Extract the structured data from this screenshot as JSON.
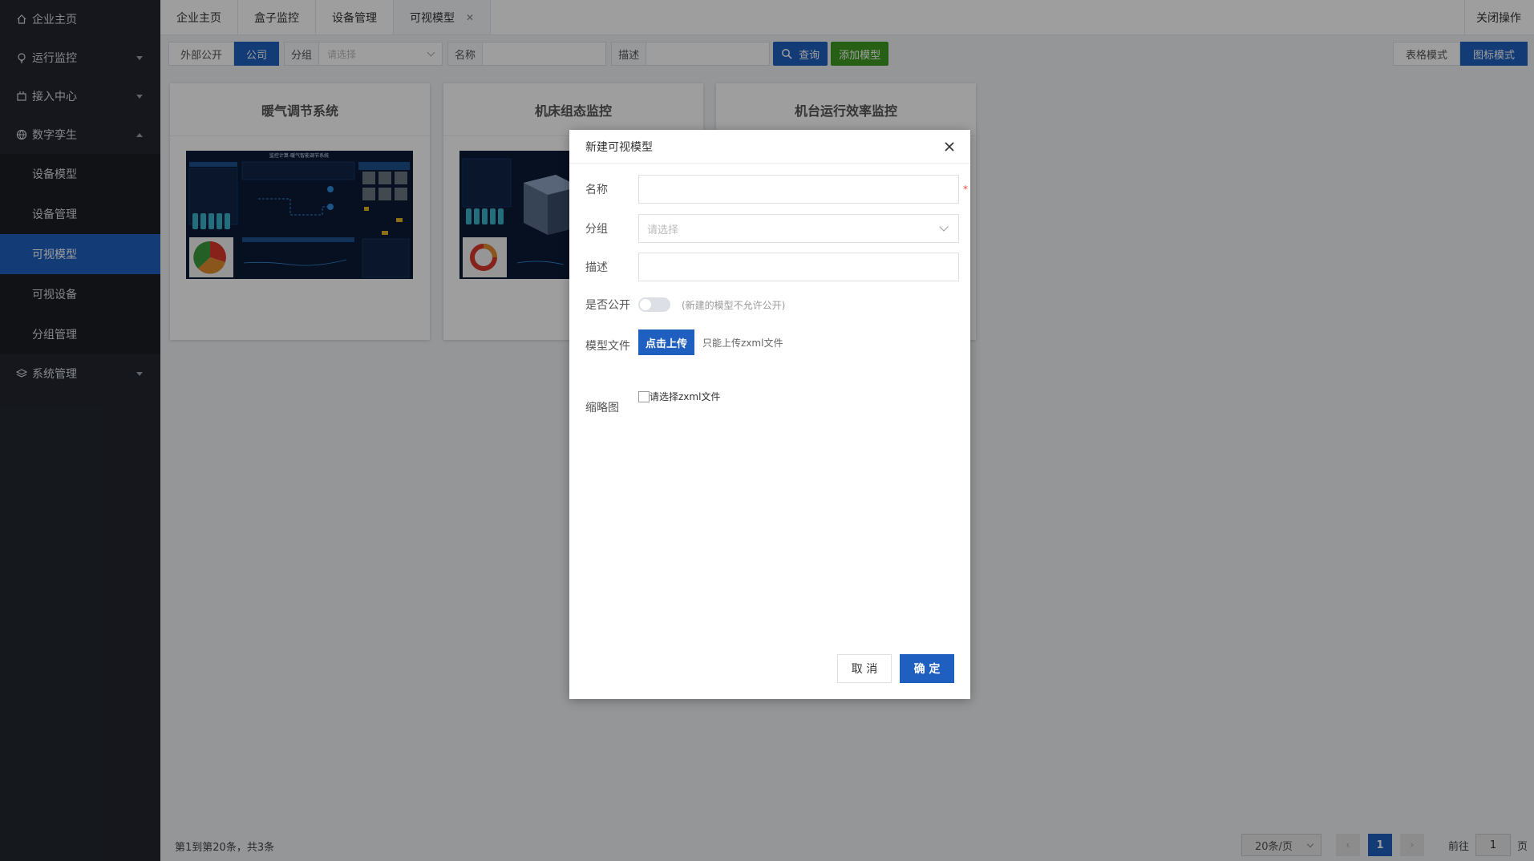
{
  "sidebar": {
    "items": [
      {
        "label": "企业主页",
        "icon": "home-icon"
      },
      {
        "label": "运行监控",
        "icon": "bulb-icon"
      },
      {
        "label": "接入中心",
        "icon": "plug-icon"
      },
      {
        "label": "数字孪生",
        "icon": "globe-icon"
      }
    ],
    "sub_items": [
      "设备模型",
      "设备管理",
      "可视模型",
      "可视设备",
      "分组管理"
    ],
    "system": {
      "label": "系统管理",
      "icon": "layers-icon"
    }
  },
  "tabs": [
    {
      "label": "企业主页"
    },
    {
      "label": "盒子监控"
    },
    {
      "label": "设备管理"
    },
    {
      "label": "可视模型"
    }
  ],
  "close_ops": "关闭操作",
  "toolbar": {
    "external_public": "外部公开",
    "company": "公司",
    "group_label": "分组",
    "group_placeholder": "请选择",
    "name_label": "名称",
    "desc_label": "描述",
    "query": "查询",
    "add_model": "添加模型",
    "table_mode": "表格模式",
    "icon_mode": "图标模式"
  },
  "cards": [
    {
      "title": "暖气调节系统",
      "thumb_heading": "监控计算-暖气智能调节系统"
    },
    {
      "title": "机床组态监控"
    },
    {
      "title": "机台运行效率监控"
    }
  ],
  "dialog": {
    "title": "新建可视模型",
    "name_label": "名称",
    "group_label": "分组",
    "group_placeholder": "请选择",
    "desc_label": "描述",
    "public_label": "是否公开",
    "public_hint": "(新建的模型不允许公开)",
    "file_label": "模型文件",
    "upload_btn": "点击上传",
    "upload_hint": "只能上传zxml文件",
    "thumb_label": "缩略图",
    "thumb_check": "请选择zxml文件",
    "cancel": "取 消",
    "ok": "确 定"
  },
  "footer": {
    "total": "第1到第20条，共3条",
    "page_size": "20条/页",
    "current_page": "1",
    "goto": "前往",
    "goto_value": "1",
    "page_suffix": "页"
  },
  "colors": {
    "primary": "#1f5fbf",
    "success": "#3f9b22",
    "sidebar": "#22262e"
  }
}
